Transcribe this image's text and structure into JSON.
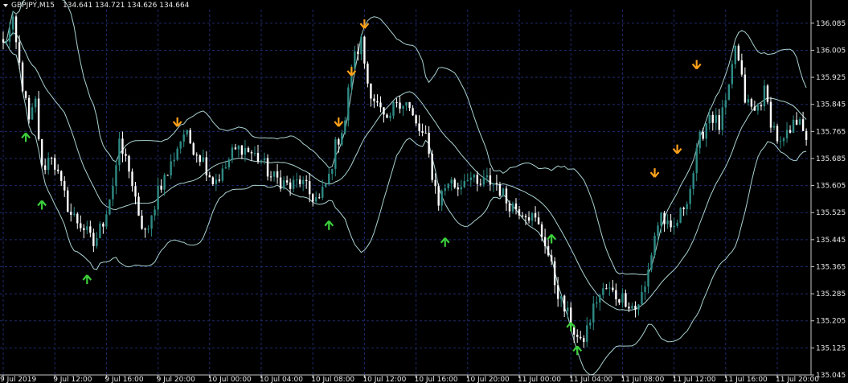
{
  "header": {
    "symbol_text": "GBPJPY,M15",
    "ohlc_text": "134.641 134.721 134.626 134.664"
  },
  "colors": {
    "background": "#000000",
    "grid": "#1f2a6b",
    "frame": "#c8c8c8",
    "text": "#e6e6e6",
    "bull_candle": "#2e8b84",
    "bear_candle": "#ffffff",
    "band": "#a9d2d0",
    "buy_arrow": "#3ccf3c",
    "sell_arrow": "#ffa21a"
  },
  "chart_data": {
    "type": "candlestick",
    "ylim": [
      135.045,
      136.125
    ],
    "y_ticks": [
      "136.085",
      "136.005",
      "135.925",
      "135.845",
      "135.765",
      "135.685",
      "135.605",
      "135.525",
      "135.445",
      "135.365",
      "135.285",
      "135.205",
      "135.125",
      "135.045"
    ],
    "x_ticks": [
      "9 Jul 2019",
      "9 Jul 12:00",
      "9 Jul 16:00",
      "9 Jul 20:00",
      "10 Jul 00:00",
      "10 Jul 04:00",
      "10 Jul 08:00",
      "10 Jul 12:00",
      "10 Jul 16:00",
      "10 Jul 20:00",
      "11 Jul 00:00",
      "11 Jul 04:00",
      "11 Jul 08:00",
      "11 Jul 12:00",
      "11 Jul 16:00",
      "11 Jul 20:00"
    ],
    "bars_per_tick": 16,
    "anchors": [
      [
        0,
        136.02
      ],
      [
        3,
        136.08
      ],
      [
        6,
        135.9
      ],
      [
        8,
        135.79
      ],
      [
        10,
        135.85
      ],
      [
        12,
        135.65
      ],
      [
        15,
        135.7
      ],
      [
        18,
        135.6
      ],
      [
        21,
        135.52
      ],
      [
        25,
        135.48
      ],
      [
        28,
        135.43
      ],
      [
        31,
        135.5
      ],
      [
        34,
        135.61
      ],
      [
        36,
        135.72
      ],
      [
        39,
        135.66
      ],
      [
        42,
        135.5
      ],
      [
        45,
        135.46
      ],
      [
        48,
        135.6
      ],
      [
        51,
        135.64
      ],
      [
        54,
        135.72
      ],
      [
        56,
        135.76
      ],
      [
        59,
        135.72
      ],
      [
        62,
        135.68
      ],
      [
        65,
        135.62
      ],
      [
        68,
        135.64
      ],
      [
        71,
        135.7
      ],
      [
        74,
        135.72
      ],
      [
        77,
        135.7
      ],
      [
        80,
        135.68
      ],
      [
        83,
        135.63
      ],
      [
        86,
        135.62
      ],
      [
        89,
        135.6
      ],
      [
        92,
        135.62
      ],
      [
        95,
        135.58
      ],
      [
        98,
        135.56
      ],
      [
        101,
        135.63
      ],
      [
        103,
        135.72
      ],
      [
        106,
        135.8
      ],
      [
        108,
        135.96
      ],
      [
        111,
        136.03
      ],
      [
        113,
        135.91
      ],
      [
        116,
        135.84
      ],
      [
        119,
        135.78
      ],
      [
        122,
        135.86
      ],
      [
        125,
        135.85
      ],
      [
        128,
        135.78
      ],
      [
        131,
        135.74
      ],
      [
        133,
        135.64
      ],
      [
        135,
        135.56
      ],
      [
        138,
        135.62
      ],
      [
        141,
        135.6
      ],
      [
        144,
        135.64
      ],
      [
        147,
        135.6
      ],
      [
        150,
        135.62
      ],
      [
        153,
        135.61
      ],
      [
        156,
        135.56
      ],
      [
        159,
        135.54
      ],
      [
        162,
        135.53
      ],
      [
        165,
        135.5
      ],
      [
        168,
        135.44
      ],
      [
        171,
        135.32
      ],
      [
        173,
        135.26
      ],
      [
        176,
        135.2
      ],
      [
        179,
        135.13
      ],
      [
        181,
        135.18
      ],
      [
        184,
        135.27
      ],
      [
        187,
        135.3
      ],
      [
        190,
        135.28
      ],
      [
        193,
        135.27
      ],
      [
        196,
        135.24
      ],
      [
        199,
        135.3
      ],
      [
        202,
        135.46
      ],
      [
        204,
        135.52
      ],
      [
        207,
        135.46
      ],
      [
        210,
        135.52
      ],
      [
        213,
        135.6
      ],
      [
        216,
        135.74
      ],
      [
        219,
        135.82
      ],
      [
        222,
        135.78
      ],
      [
        225,
        135.88
      ],
      [
        227,
        136.02
      ],
      [
        230,
        135.86
      ],
      [
        233,
        135.82
      ],
      [
        236,
        135.88
      ],
      [
        238,
        135.8
      ],
      [
        241,
        135.72
      ],
      [
        244,
        135.76
      ],
      [
        247,
        135.82
      ],
      [
        249,
        135.74
      ]
    ],
    "bands_period": 20,
    "bands_deviation": 2,
    "signals": [
      {
        "type": "buy",
        "bar": 7,
        "price": 135.76
      },
      {
        "type": "buy",
        "bar": 12,
        "price": 135.56
      },
      {
        "type": "buy",
        "bar": 26,
        "price": 135.34
      },
      {
        "type": "sell",
        "bar": 54,
        "price": 135.78
      },
      {
        "type": "buy",
        "bar": 101,
        "price": 135.5
      },
      {
        "type": "sell",
        "bar": 104,
        "price": 135.78
      },
      {
        "type": "sell",
        "bar": 108,
        "price": 135.93
      },
      {
        "type": "sell",
        "bar": 112,
        "price": 136.07
      },
      {
        "type": "buy",
        "bar": 137,
        "price": 135.45
      },
      {
        "type": "buy",
        "bar": 170,
        "price": 135.46
      },
      {
        "type": "buy",
        "bar": 176,
        "price": 135.2
      },
      {
        "type": "buy",
        "bar": 178,
        "price": 135.13
      },
      {
        "type": "sell",
        "bar": 202,
        "price": 135.63
      },
      {
        "type": "sell",
        "bar": 209,
        "price": 135.7
      },
      {
        "type": "sell",
        "bar": 215,
        "price": 135.95
      }
    ]
  }
}
